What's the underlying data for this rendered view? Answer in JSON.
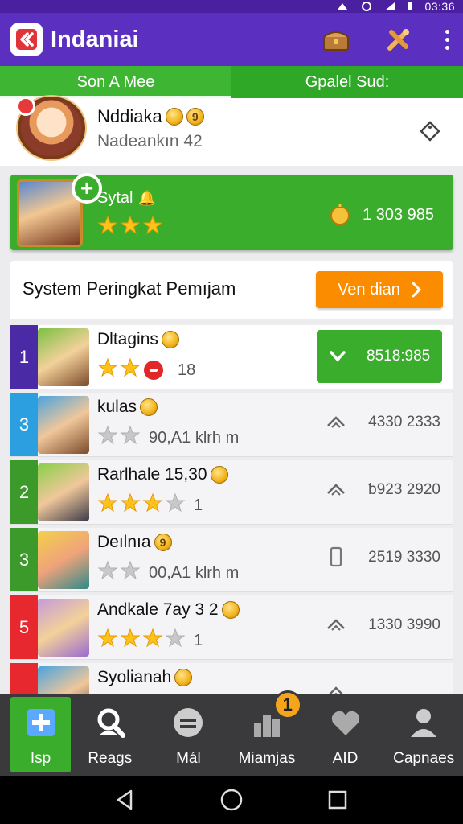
{
  "status_bar": {
    "time": "03:36"
  },
  "app": {
    "title": "Indaniai",
    "brand_color": "#5b2fc0",
    "accent_green": "#3aad2c",
    "accent_orange": "#fb8c00"
  },
  "tabs": [
    {
      "label": "Son A Mee",
      "active": true
    },
    {
      "label": "Gpalel Sud:",
      "active": false
    }
  ],
  "profile": {
    "name": "Nddiaka",
    "badge": "9",
    "subtitle": "Nadeankın 42"
  },
  "highlight": {
    "name": "Sytal",
    "stars_filled": 3,
    "stars_total": 3,
    "score": "1 303 985"
  },
  "section": {
    "title": "System Peringkat Pemıjam",
    "button_label": "Ven dian"
  },
  "leaderboard": [
    {
      "rank": "1",
      "rank_color": "#4b2aa5",
      "name": "Dltagins",
      "stars_filled": 2,
      "stars_total": 2,
      "extra": "18",
      "score": "8518:985",
      "highlight": true
    },
    {
      "rank": "3",
      "rank_color": "#2b9fe0",
      "name": "kulas",
      "stars_filled": 0,
      "stars_total": 2,
      "extra": "90,A1 klrh m",
      "score": "4330 2333",
      "icon": "chevron-up-icon"
    },
    {
      "rank": "2",
      "rank_color": "#3c9a2a",
      "name": "Rarlhale 15,30",
      "stars_filled": 3,
      "stars_total": 4,
      "extra": "1",
      "score": "ƅ923 2920",
      "icon": "chevron-up-icon"
    },
    {
      "rank": "3",
      "rank_color": "#3c9a2a",
      "name": "Deılnıa",
      "badge": "9",
      "stars_filled": 0,
      "stars_total": 2,
      "extra": "00,A1 klrh m",
      "score": "2519 3330",
      "icon": "phone-icon"
    },
    {
      "rank": "5",
      "rank_color": "#e8282f",
      "name": "Andkale 7ay 3 2",
      "stars_filled": 3,
      "stars_total": 4,
      "extra": "1",
      "score": "1330 3990",
      "icon": "chevron-up-icon"
    },
    {
      "rank": "",
      "rank_color": "#e8282f",
      "name": "Syolianah",
      "stars_filled": 0,
      "stars_total": 0,
      "extra": "",
      "score": "",
      "icon": "chevron-up-icon"
    }
  ],
  "bottom_nav": [
    {
      "label": "Isp",
      "icon": "plus-icon",
      "active": true
    },
    {
      "label": "Reags",
      "icon": "search-user-icon"
    },
    {
      "label": "Mál",
      "icon": "chat-icon"
    },
    {
      "label": "Miamjas",
      "icon": "buildings-icon",
      "badge": "1"
    },
    {
      "label": "AID",
      "icon": "heart-icon"
    },
    {
      "label": "Capnaes",
      "icon": "person-icon"
    }
  ]
}
